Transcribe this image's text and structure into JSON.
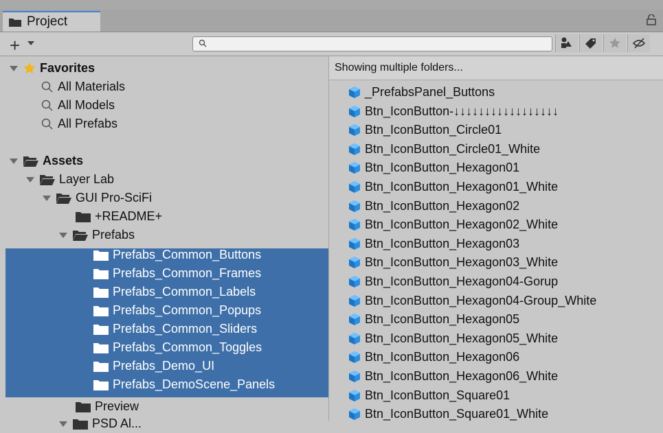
{
  "tab": {
    "label": "Project"
  },
  "search": {
    "placeholder": ""
  },
  "toolbar": {
    "create_icon": "plus-icon",
    "buttons": [
      "filter-by-type-icon",
      "filter-by-label-icon",
      "favorites-star-icon",
      "hidden-packages-icon"
    ]
  },
  "favorites": {
    "label": "Favorites",
    "items": [
      "All Materials",
      "All Models",
      "All Prefabs"
    ]
  },
  "assets": {
    "label": "Assets",
    "layerlab": "Layer Lab",
    "guiprosci": "GUI Pro-SciFi",
    "readme": "+README+",
    "prefabs": "Prefabs",
    "prefab_folders": [
      "Prefabs_Common_Buttons",
      "Prefabs_Common_Frames",
      "Prefabs_Common_Labels",
      "Prefabs_Common_Popups",
      "Prefabs_Common_Sliders",
      "Prefabs_Common_Toggles",
      "Prefabs_Demo_UI",
      "Prefabs_DemoScene_Panels"
    ],
    "preview": "Preview",
    "cutoff": "PSD Al..."
  },
  "right": {
    "header": "Showing multiple folders...",
    "items": [
      "_PrefabsPanel_Buttons",
      "Btn_IconButton-↓↓↓↓↓↓↓↓↓↓↓↓↓↓↓↓↓",
      "Btn_IconButton_Circle01",
      "Btn_IconButton_Circle01_White",
      "Btn_IconButton_Hexagon01",
      "Btn_IconButton_Hexagon01_White",
      "Btn_IconButton_Hexagon02",
      "Btn_IconButton_Hexagon02_White",
      "Btn_IconButton_Hexagon03",
      "Btn_IconButton_Hexagon03_White",
      "Btn_IconButton_Hexagon04-Gorup",
      "Btn_IconButton_Hexagon04-Group_White",
      "Btn_IconButton_Hexagon05",
      "Btn_IconButton_Hexagon05_White",
      "Btn_IconButton_Hexagon06",
      "Btn_IconButton_Hexagon06_White",
      "Btn_IconButton_Square01",
      "Btn_IconButton_Square01_White"
    ]
  },
  "colors": {
    "selection": "#3e6fa8",
    "accent": "#3d7fd6",
    "prefab_icon": "#2b8fe0"
  }
}
